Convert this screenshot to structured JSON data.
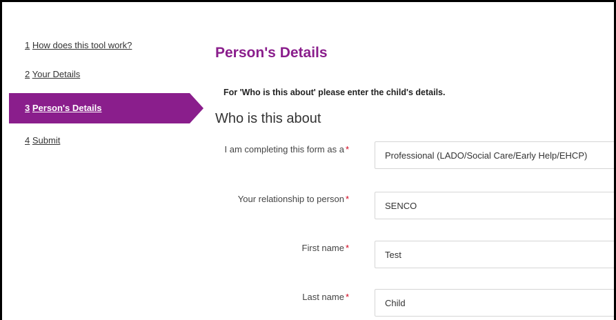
{
  "sidebar": {
    "items": [
      {
        "num": "1",
        "label": "How does this tool work?",
        "active": false
      },
      {
        "num": "2",
        "label": "Your Details",
        "active": false
      },
      {
        "num": "3",
        "label": "Person's Details",
        "active": true
      },
      {
        "num": "4",
        "label": "Submit",
        "active": false
      }
    ]
  },
  "main": {
    "title": "Person's Details",
    "notice": "For 'Who is this about' please enter the child's details.",
    "section_heading": "Who is this about",
    "required_marker": "*",
    "fields": {
      "completing_as": {
        "label": "I am completing this form as a",
        "value": "Professional (LADO/Social Care/Early Help/EHCP)"
      },
      "relationship": {
        "label": "Your relationship to person",
        "value": "SENCO"
      },
      "first_name": {
        "label": "First name",
        "value": "Test"
      },
      "last_name": {
        "label": "Last name",
        "value": "Child"
      }
    }
  },
  "colors": {
    "accent": "#8a1e8c",
    "required": "#d0021b"
  }
}
